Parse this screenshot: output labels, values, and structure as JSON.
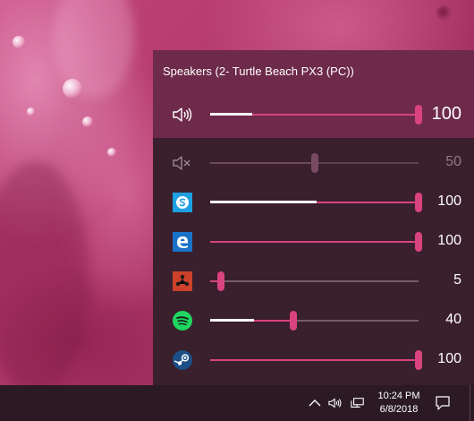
{
  "flyout": {
    "device_name": "Speakers (2- Turtle Beach PX3 (PC))",
    "master": {
      "icon": "speaker-volume-icon",
      "volume": 100,
      "volume_label": "100"
    },
    "apps": [
      {
        "name": "system-sounds",
        "icon": "speaker-muted-icon",
        "volume": 50,
        "volume_label": "50",
        "muted": true,
        "peak": 0
      },
      {
        "name": "skype",
        "icon": "skype-icon",
        "volume": 100,
        "volume_label": "100",
        "muted": false,
        "peak": 0.51
      },
      {
        "name": "edge",
        "icon": "edge-icon",
        "volume": 100,
        "volume_label": "100",
        "muted": false,
        "peak": 0
      },
      {
        "name": "rust",
        "icon": "rust-game-icon",
        "volume": 5,
        "volume_label": "5",
        "muted": false,
        "peak": 0
      },
      {
        "name": "spotify",
        "icon": "spotify-icon",
        "volume": 40,
        "volume_label": "40",
        "muted": false,
        "peak": 0.21
      },
      {
        "name": "steam",
        "icon": "steam-icon",
        "volume": 100,
        "volume_label": "100",
        "muted": false,
        "peak": 0
      }
    ],
    "master_peak": 0.2
  },
  "taskbar": {
    "time": "10:24 PM",
    "date": "6/8/2018",
    "tray_icons": [
      "chevron-up-icon",
      "speaker-volume-icon",
      "network-icon"
    ],
    "action_center_icon": "action-center-icon"
  },
  "colors": {
    "accent": "#d9437f",
    "flyout_bg": "#3a1f2c",
    "flyout_header": "#6e2a4a",
    "taskbar_bg": "#2b1a24"
  }
}
